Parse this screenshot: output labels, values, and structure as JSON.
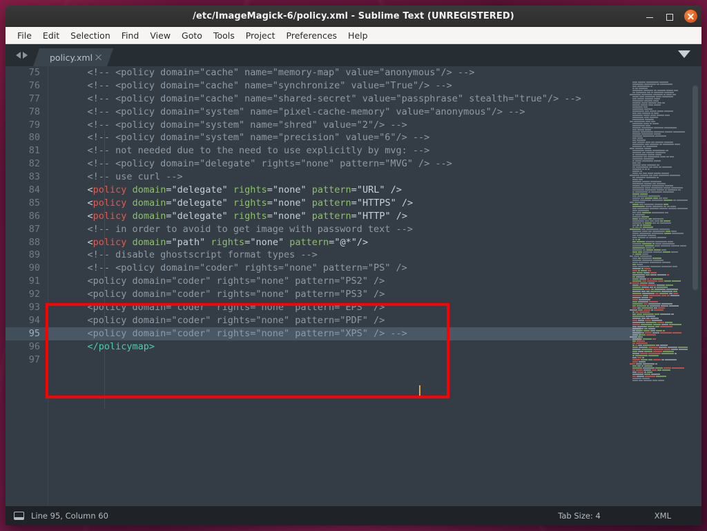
{
  "window": {
    "title": "/etc/ImageMagick-6/policy.xml - Sublime Text (UNREGISTERED)",
    "controls": {
      "minimize": "minimize",
      "maximize": "maximize",
      "close": "close"
    }
  },
  "menubar": {
    "items": [
      {
        "label": "File"
      },
      {
        "label": "Edit"
      },
      {
        "label": "Selection"
      },
      {
        "label": "Find"
      },
      {
        "label": "View"
      },
      {
        "label": "Goto"
      },
      {
        "label": "Tools"
      },
      {
        "label": "Project"
      },
      {
        "label": "Preferences"
      },
      {
        "label": "Help"
      }
    ]
  },
  "tabbar": {
    "tab_label": "policy.xml",
    "close_label": "x"
  },
  "editor": {
    "first_line_number": 75,
    "current_line": 95,
    "lines": [
      {
        "n": 75,
        "text": "<!-- <policy domain=\"cache\" name=\"memory-map\" value=\"anonymous\"/> -->"
      },
      {
        "n": 76,
        "text": "<!-- <policy domain=\"cache\" name=\"synchronize\" value=\"True\"/> -->"
      },
      {
        "n": 77,
        "text": "<!-- <policy domain=\"cache\" name=\"shared-secret\" value=\"passphrase\" stealth=\"true\"/> -->"
      },
      {
        "n": 78,
        "text": "<!-- <policy domain=\"system\" name=\"pixel-cache-memory\" value=\"anonymous\"/> -->"
      },
      {
        "n": 79,
        "text": "<!-- <policy domain=\"system\" name=\"shred\" value=\"2\"/> -->"
      },
      {
        "n": 80,
        "text": "<!-- <policy domain=\"system\" name=\"precision\" value=\"6\"/> -->"
      },
      {
        "n": 81,
        "text": "<!-- not needed due to the need to use explicitly by mvg: -->"
      },
      {
        "n": 82,
        "text": "<!-- <policy domain=\"delegate\" rights=\"none\" pattern=\"MVG\" /> -->"
      },
      {
        "n": 83,
        "text": "<!-- use curl -->"
      },
      {
        "n": 84,
        "text": "<policy domain=\"delegate\" rights=\"none\" pattern=\"URL\" />"
      },
      {
        "n": 85,
        "text": "<policy domain=\"delegate\" rights=\"none\" pattern=\"HTTPS\" />"
      },
      {
        "n": 86,
        "text": "<policy domain=\"delegate\" rights=\"none\" pattern=\"HTTP\" />"
      },
      {
        "n": 87,
        "text": "<!-- in order to avoid to get image with password text -->"
      },
      {
        "n": 88,
        "text": "<policy domain=\"path\" rights=\"none\" pattern=\"@*\"/>"
      },
      {
        "n": 89,
        "text": "<!-- disable ghostscript format types -->"
      },
      {
        "n": 90,
        "text": "<!-- <policy domain=\"coder\" rights=\"none\" pattern=\"PS\" />"
      },
      {
        "n": 91,
        "text": "<policy domain=\"coder\" rights=\"none\" pattern=\"PS2\" />"
      },
      {
        "n": 92,
        "text": "<policy domain=\"coder\" rights=\"none\" pattern=\"PS3\" />"
      },
      {
        "n": 93,
        "text": "<policy domain=\"coder\" rights=\"none\" pattern=\"EPS\" />"
      },
      {
        "n": 94,
        "text": "<policy domain=\"coder\" rights=\"none\" pattern=\"PDF\" />"
      },
      {
        "n": 95,
        "text": "<policy domain=\"coder\" rights=\"none\" pattern=\"XPS\" /> -->"
      },
      {
        "n": 96,
        "text": "</policymap>"
      },
      {
        "n": 97,
        "text": ""
      }
    ],
    "modified_lines": [
      90,
      95
    ]
  },
  "annotation": {
    "color": "#ff0000",
    "covers_lines": "89-95"
  },
  "statusbar": {
    "position": "Line 95, Column 60",
    "tab_size": "Tab Size: 4",
    "syntax": "XML"
  },
  "colors": {
    "editor_bg": "#343d46",
    "current_line_bg": "#4a5764",
    "comment": "#8d9aa6",
    "tag": "#e05a4f",
    "attribute": "#8fbf6a",
    "string": "#c8d0d7",
    "gutter_marker": "#e8a34a",
    "caret": "#e0a44e",
    "accent_close": "#e2551a",
    "annotation": "#ff0000"
  }
}
